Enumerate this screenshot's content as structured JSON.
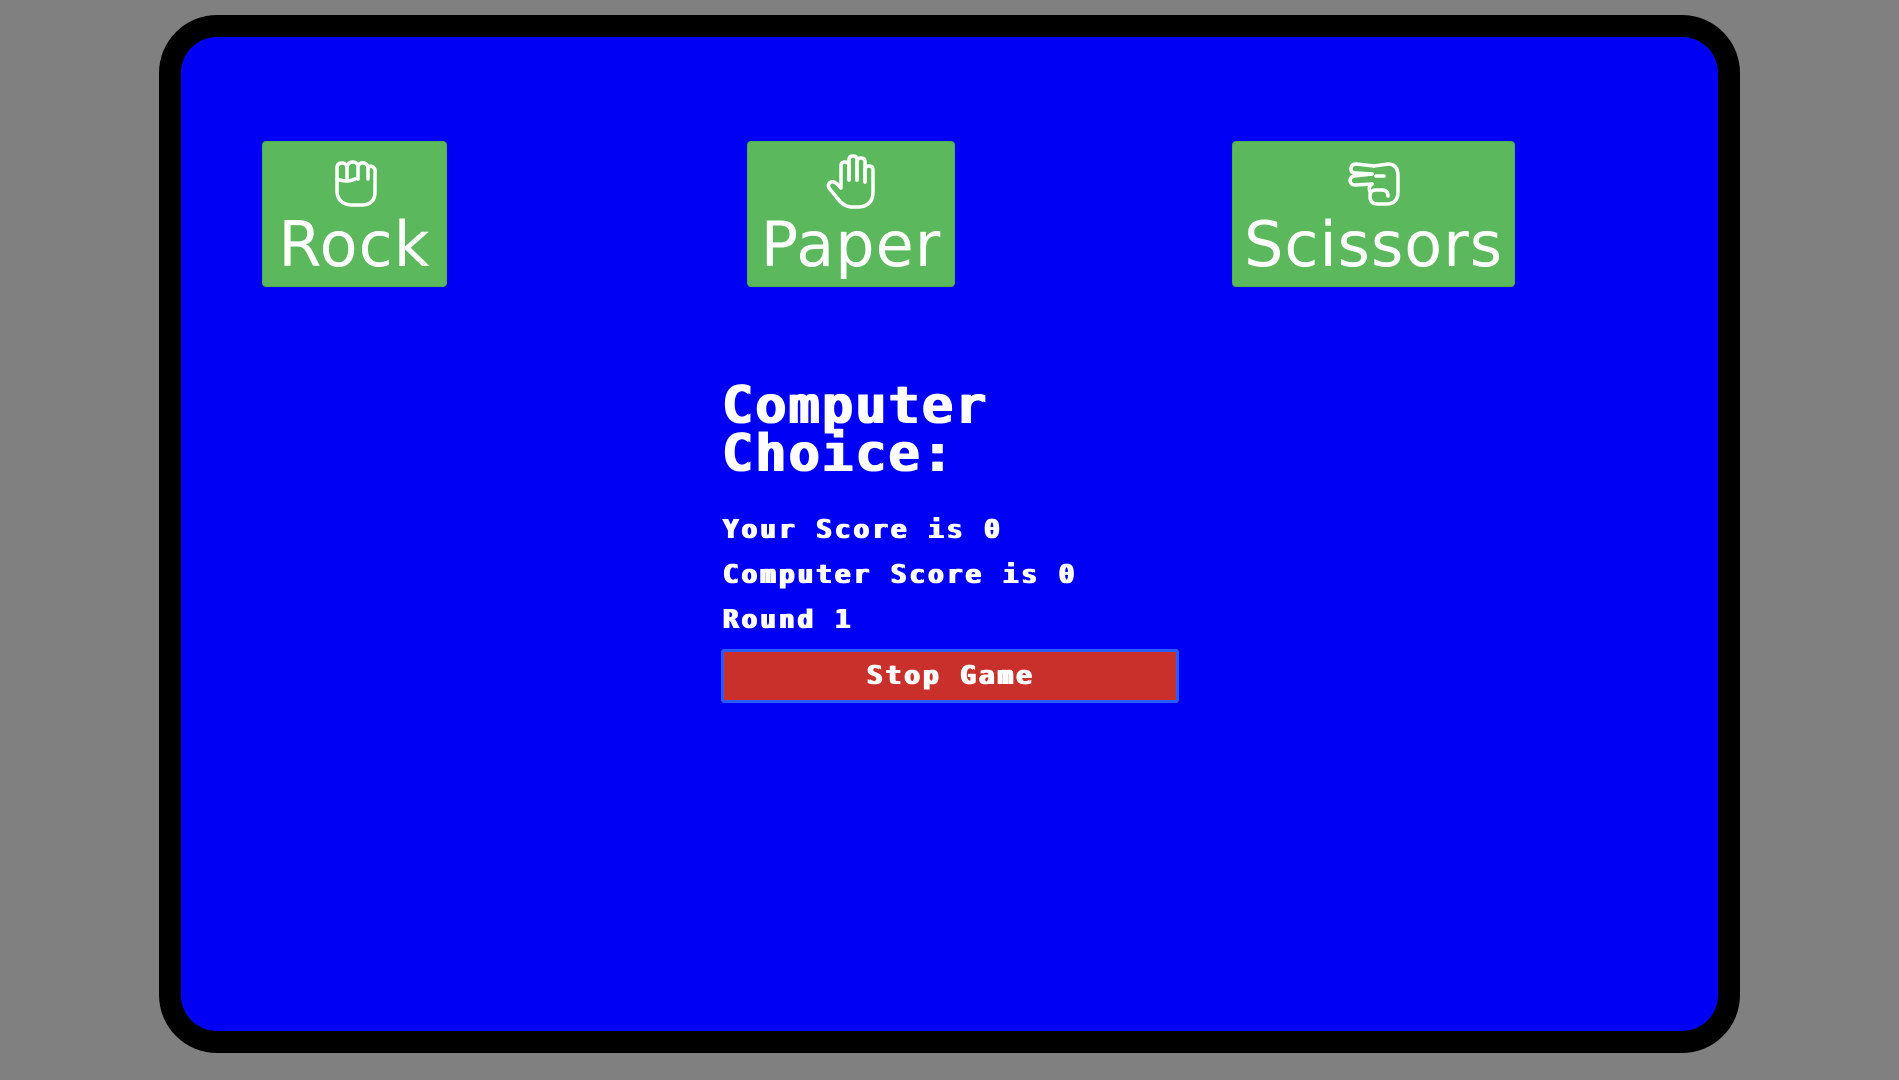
{
  "buttons": {
    "rock": {
      "label": "Rock",
      "icon": "fist-icon"
    },
    "paper": {
      "label": "Paper",
      "icon": "open-hand-icon"
    },
    "scissors": {
      "label": "Scissors",
      "icon": "scissors-hand-icon"
    }
  },
  "status": {
    "computer_choice": "Computer Choice:",
    "your_score": "Your Score is 0",
    "computer_score": "Computer Score is 0",
    "round": "Round 1"
  },
  "stop_button": {
    "label": "Stop Game"
  },
  "colors": {
    "background": "#808080",
    "frame": "#000000",
    "screen": "#0000f5",
    "choice_button": "#5cb85c",
    "stop_button": "#c9302c",
    "text": "#ffffff"
  }
}
